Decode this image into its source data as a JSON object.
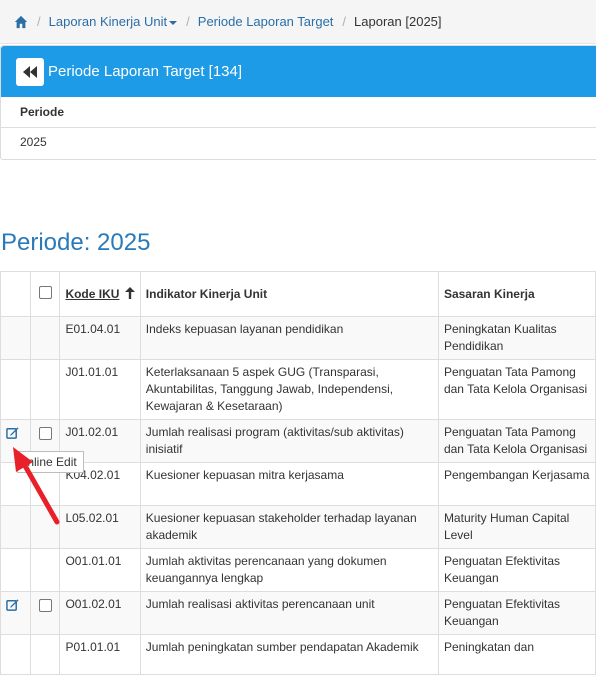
{
  "breadcrumb": {
    "item1": "Laporan Kinerja Unit",
    "item2": "Periode Laporan Target",
    "item3": "Laporan [2025]"
  },
  "panel": {
    "title": "Periode Laporan Target [134]",
    "label": "Periode",
    "value": "2025"
  },
  "section": {
    "heading": "Periode: 2025"
  },
  "table": {
    "headers": {
      "kode": "Kode IKU",
      "indikator": "Indikator Kinerja Unit",
      "sasaran": "Sasaran Kinerja"
    },
    "rows": [
      {
        "kode": "E01.04.01",
        "indikator": "Indeks kepuasan layanan pendidikan",
        "sasaran": "Peningkatan Kualitas Pendidikan"
      },
      {
        "kode": "J01.01.01",
        "indikator": "Keterlaksanaan 5 aspek GUG (Transparasi, Akuntabilitas, Tanggung Jawab, Independensi, Kewajaran & Kesetaraan)",
        "sasaran": "Penguatan Tata Pamong dan Tata Kelola Organisasi"
      },
      {
        "kode": "J01.02.01",
        "indikator": "Jumlah realisasi program (aktivitas/sub aktivitas) inisiatif",
        "sasaran": "Penguatan Tata Pamong dan Tata Kelola Organisasi"
      },
      {
        "kode": "K04.02.01",
        "indikator": "Kuesioner kepuasan mitra kerjasama",
        "sasaran": "Pengembangan Kerjasama"
      },
      {
        "kode": "L05.02.01",
        "indikator": "Kuesioner kepuasan stakeholder terhadap layanan akademik",
        "sasaran": "Maturity Human Capital Level"
      },
      {
        "kode": "O01.01.01",
        "indikator": "Jumlah aktivitas perencanaan yang dokumen keuangannya lengkap",
        "sasaran": "Penguatan Efektivitas Keuangan"
      },
      {
        "kode": "O01.02.01",
        "indikator": "Jumlah realisasi aktivitas perencanaan unit",
        "sasaran": "Penguatan Efektivitas Keuangan"
      },
      {
        "kode": "P01.01.01",
        "indikator": "Jumlah peningkatan sumber pendapatan Akademik",
        "sasaran": "Peningkatan dan"
      }
    ]
  },
  "tooltip": "Inline Edit",
  "colors": {
    "accent": "#1e9be6",
    "heading": "#2a7ab9",
    "link": "#2a6ea6",
    "arrow": "#e8202a"
  }
}
